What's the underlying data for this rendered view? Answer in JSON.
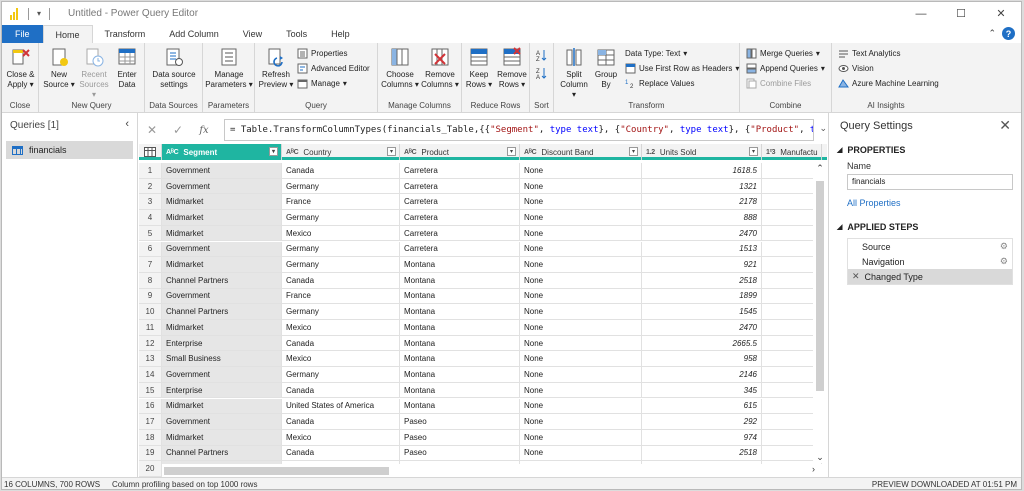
{
  "window": {
    "title": "Untitled - Power Query Editor",
    "minimize": "—",
    "maximize": "☐",
    "close": "✕"
  },
  "tabs": [
    "File",
    "Home",
    "Transform",
    "Add Column",
    "View",
    "Tools",
    "Help"
  ],
  "ribbon": {
    "close": {
      "btn": "Close &",
      "btn2": "Apply",
      "group": "Close"
    },
    "new_query": {
      "new_source": "New",
      "new_source2": "Source",
      "recent": "Recent",
      "recent2": "Sources",
      "enter": "Enter",
      "enter2": "Data",
      "group": "New Query"
    },
    "data_sources": {
      "btn": "Data source",
      "btn2": "settings",
      "group": "Data Sources"
    },
    "parameters": {
      "btn": "Manage",
      "btn2": "Parameters",
      "group": "Parameters"
    },
    "query": {
      "refresh": "Refresh",
      "refresh2": "Preview",
      "properties": "Properties",
      "advanced": "Advanced Editor",
      "manage": "Manage",
      "group": "Query"
    },
    "manage_columns": {
      "choose": "Choose",
      "choose2": "Columns",
      "remove": "Remove",
      "remove2": "Columns",
      "group": "Manage Columns"
    },
    "reduce_rows": {
      "keep": "Keep",
      "keep2": "Rows",
      "remove": "Remove",
      "remove2": "Rows",
      "group": "Reduce Rows"
    },
    "sort": {
      "group": "Sort"
    },
    "transform": {
      "split": "Split",
      "split2": "Column",
      "group_by": "Group",
      "group_by2": "By",
      "data_type": "Data Type: Text",
      "first_row": "Use First Row as Headers",
      "replace": "Replace Values",
      "group": "Transform"
    },
    "combine": {
      "merge": "Merge Queries",
      "append": "Append Queries",
      "combine_files": "Combine Files",
      "group": "Combine"
    },
    "ai": {
      "text": "Text Analytics",
      "vision": "Vision",
      "aml": "Azure Machine Learning",
      "group": "AI Insights"
    }
  },
  "queries": {
    "header": "Queries [1]",
    "items": [
      "financials"
    ]
  },
  "formula": {
    "p1": "= Table.TransformColumnTypes(financials_Table,{{",
    "s1": "\"Segment\"",
    "p2": ", ",
    "k1": "type text",
    "p3": "}, {",
    "s2": "\"Country\"",
    "p4": ", ",
    "k2": "type text",
    "p5": "}, {",
    "s3": "\"Product\"",
    "p6": ", ",
    "k3": "type"
  },
  "grid": {
    "columns": [
      {
        "type": "AᴮC",
        "name": "Segment"
      },
      {
        "type": "AᴮC",
        "name": "Country"
      },
      {
        "type": "AᴮC",
        "name": "Product"
      },
      {
        "type": "AᴮC",
        "name": "Discount Band"
      },
      {
        "type": "1.2",
        "name": "Units Sold"
      },
      {
        "type": "1²3",
        "name": "Manufactu"
      }
    ],
    "rows": [
      [
        "1",
        "Government",
        "Canada",
        "Carretera",
        "None",
        "1618.5"
      ],
      [
        "2",
        "Government",
        "Germany",
        "Carretera",
        "None",
        "1321"
      ],
      [
        "3",
        "Midmarket",
        "France",
        "Carretera",
        "None",
        "2178"
      ],
      [
        "4",
        "Midmarket",
        "Germany",
        "Carretera",
        "None",
        "888"
      ],
      [
        "5",
        "Midmarket",
        "Mexico",
        "Carretera",
        "None",
        "2470"
      ],
      [
        "6",
        "Government",
        "Germany",
        "Carretera",
        "None",
        "1513"
      ],
      [
        "7",
        "Midmarket",
        "Germany",
        "Montana",
        "None",
        "921"
      ],
      [
        "8",
        "Channel Partners",
        "Canada",
        "Montana",
        "None",
        "2518"
      ],
      [
        "9",
        "Government",
        "France",
        "Montana",
        "None",
        "1899"
      ],
      [
        "10",
        "Channel Partners",
        "Germany",
        "Montana",
        "None",
        "1545"
      ],
      [
        "11",
        "Midmarket",
        "Mexico",
        "Montana",
        "None",
        "2470"
      ],
      [
        "12",
        "Enterprise",
        "Canada",
        "Montana",
        "None",
        "2665.5"
      ],
      [
        "13",
        "Small Business",
        "Mexico",
        "Montana",
        "None",
        "958"
      ],
      [
        "14",
        "Government",
        "Germany",
        "Montana",
        "None",
        "2146"
      ],
      [
        "15",
        "Enterprise",
        "Canada",
        "Montana",
        "None",
        "345"
      ],
      [
        "16",
        "Midmarket",
        "United States of America",
        "Montana",
        "None",
        "615"
      ],
      [
        "17",
        "Government",
        "Canada",
        "Paseo",
        "None",
        "292"
      ],
      [
        "18",
        "Midmarket",
        "Mexico",
        "Paseo",
        "None",
        "974"
      ],
      [
        "19",
        "Channel Partners",
        "Canada",
        "Paseo",
        "None",
        "2518"
      ],
      [
        "20",
        "",
        "",
        "",
        "",
        ""
      ]
    ]
  },
  "settings": {
    "title": "Query Settings",
    "properties": "PROPERTIES",
    "name_label": "Name",
    "name_value": "financials",
    "all_properties": "All Properties",
    "applied_steps": "APPLIED STEPS",
    "steps": [
      "Source",
      "Navigation",
      "Changed Type"
    ]
  },
  "status": {
    "columns": "16 COLUMNS, 700 ROWS",
    "profiling": "Column profiling based on top 1000 rows",
    "preview": "PREVIEW DOWNLOADED AT 01:51 PM"
  },
  "colors": {
    "accent": "#1f6fc5",
    "selected_column": "#1fb5a1",
    "brand": "#f2c811"
  }
}
